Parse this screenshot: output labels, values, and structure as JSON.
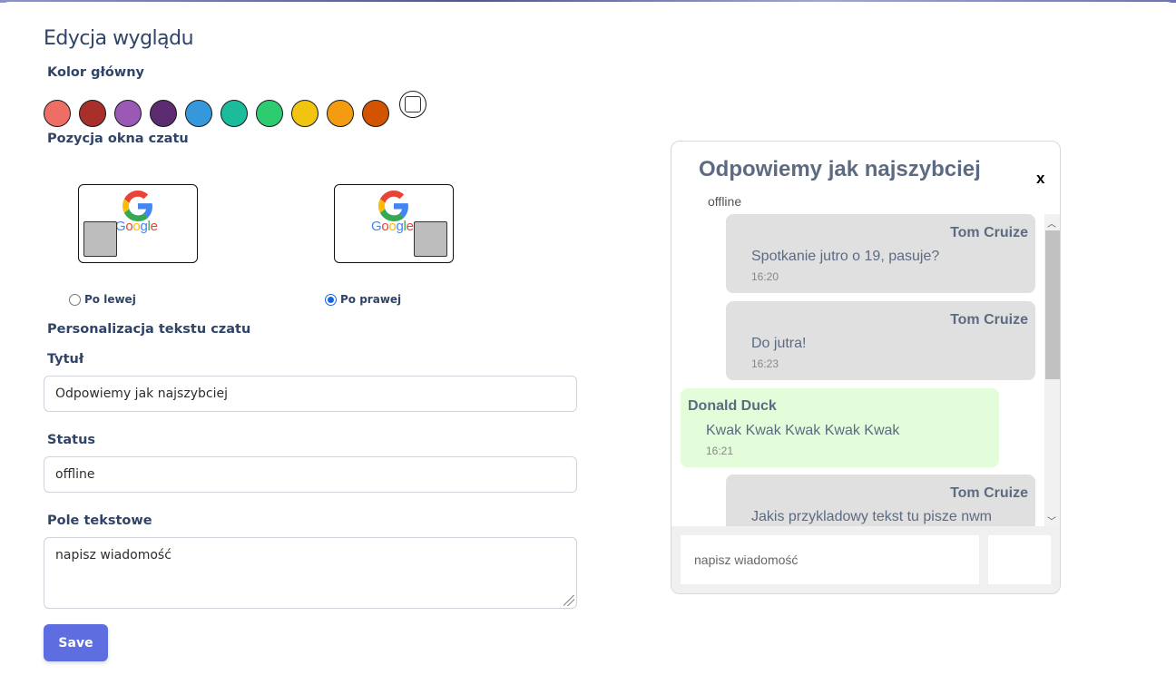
{
  "page": {
    "title": "Edycja wyglądu"
  },
  "colors": {
    "label": "Kolor główny",
    "swatches": [
      "#ec6e65",
      "#a9302a",
      "#9b59b6",
      "#5b2c6f",
      "#3498db",
      "#1abc9c",
      "#2ecc71",
      "#f1c40f",
      "#f39c12",
      "#d35400"
    ],
    "custom_icon": "custom-color-icon"
  },
  "position": {
    "label": "Pozycja okna czatu",
    "left_label": "Po lewej",
    "right_label": "Po prawej",
    "selected": "right",
    "logo_word": [
      "G",
      "o",
      "o",
      "g",
      "l",
      "e"
    ]
  },
  "text_personalization": {
    "label": "Personalizacja tekstu czatu",
    "title_label": "Tytuł",
    "title_value": "Odpowiemy jak najszybciej",
    "status_label": "Status",
    "status_value": "offline",
    "textfield_label": "Pole tekstowe",
    "textfield_value": "napisz wiadomość"
  },
  "save_label": "Save",
  "chat_preview": {
    "title": "Odpowiemy jak najszybciej",
    "close": "x",
    "status": "offline",
    "messages": [
      {
        "author": "Tom Cruize",
        "text": "Spotkanie jutro o 19, pasuje?",
        "time": "16:20",
        "side": "mine"
      },
      {
        "author": "Tom Cruize",
        "text": "Do jutra!",
        "time": "16:23",
        "side": "mine"
      },
      {
        "author": "Donald Duck",
        "text": "Kwak Kwak Kwak Kwak Kwak",
        "time": "16:21",
        "side": "theirs"
      },
      {
        "author": "Tom Cruize",
        "text": "Jakis przykladowy tekst tu pisze nwm",
        "time": "",
        "side": "mine"
      }
    ],
    "input_placeholder": "napisz wiadomość"
  }
}
